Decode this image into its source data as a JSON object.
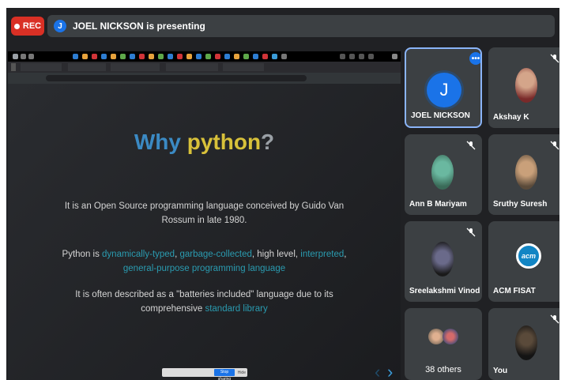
{
  "topbar": {
    "rec_label": "REC",
    "presenter_initial": "J",
    "presenting_text": "JOEL NICKSON is presenting"
  },
  "slide": {
    "title_part1": "Why ",
    "title_part2": "python",
    "title_part3": "?",
    "para1": "It is an Open Source programming language conceived by Guido Van Rossum in late 1980.",
    "para2_prefix": "Python is ",
    "para2_links": [
      "dynamically-typed",
      "garbage-collected",
      "interpreted",
      "general-purpose programming language"
    ],
    "para2_mid1": ", ",
    "para2_mid2": ", high level, ",
    "para2_mid3": ", ",
    "para3_prefix": "It is often described as a \"batteries included\" language due to its comprehensive ",
    "para3_link": "standard library",
    "share_stop_label": "Stop sharing",
    "share_hide_label": "Hide"
  },
  "participants": [
    {
      "name": "JOEL NICKSON",
      "initial": "J",
      "type": "avatar",
      "active": true
    },
    {
      "name": "Akshay K",
      "type": "photo",
      "muted": true
    },
    {
      "name": "Ann B Mariyam",
      "type": "photo",
      "muted": true
    },
    {
      "name": "Sruthy Suresh",
      "type": "photo",
      "muted": true
    },
    {
      "name": "Sreelakshmi Vinod",
      "type": "photo",
      "muted": true
    },
    {
      "name": "ACM FISAT",
      "type": "logo",
      "logo_text": "acm"
    },
    {
      "name": "38 others",
      "type": "group"
    },
    {
      "name": "You",
      "type": "photo",
      "muted": true
    }
  ],
  "colors": {
    "accent": "#1a73e8",
    "rec": "#d93025",
    "title_blue": "#3b8ac4",
    "title_yellow": "#d8c13a",
    "link": "#2a9bb0"
  }
}
